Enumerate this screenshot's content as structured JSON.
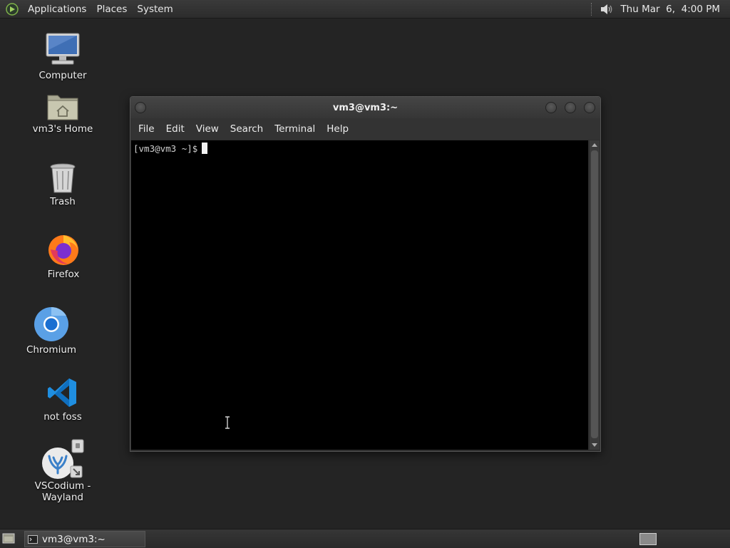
{
  "top_panel": {
    "menus": [
      "Applications",
      "Places",
      "System"
    ],
    "clock": "Thu Mar  6,  4:00 PM",
    "icons": {
      "menu_logo": "mate-logo-icon",
      "volume": "speaker-volume-icon"
    }
  },
  "desktop": {
    "icons": [
      {
        "label": "Computer",
        "icon": "computer-monitor-icon"
      },
      {
        "label": "vm3's Home",
        "icon": "home-folder-icon"
      },
      {
        "label": "Trash",
        "icon": "trash-can-icon"
      },
      {
        "label": "Firefox",
        "icon": "firefox-icon"
      },
      {
        "label": "Chromium",
        "icon": "chromium-icon"
      },
      {
        "label": "not foss",
        "icon": "vscode-icon"
      },
      {
        "label": "VSCodium - Wayland",
        "icon": "vscodium-icon"
      }
    ]
  },
  "terminal": {
    "title": "vm3@vm3:~",
    "menu": [
      "File",
      "Edit",
      "View",
      "Search",
      "Terminal",
      "Help"
    ],
    "prompt": "[vm3@vm3 ~]$",
    "colors": {
      "background": "#000000",
      "text": "#d0d0d0"
    }
  },
  "bottom_panel": {
    "task_label": "vm3@vm3:~",
    "icons": {
      "show_desktop": "show-desktop-icon",
      "task": "terminal-icon",
      "workspace": "workspace-switcher-icon"
    }
  }
}
